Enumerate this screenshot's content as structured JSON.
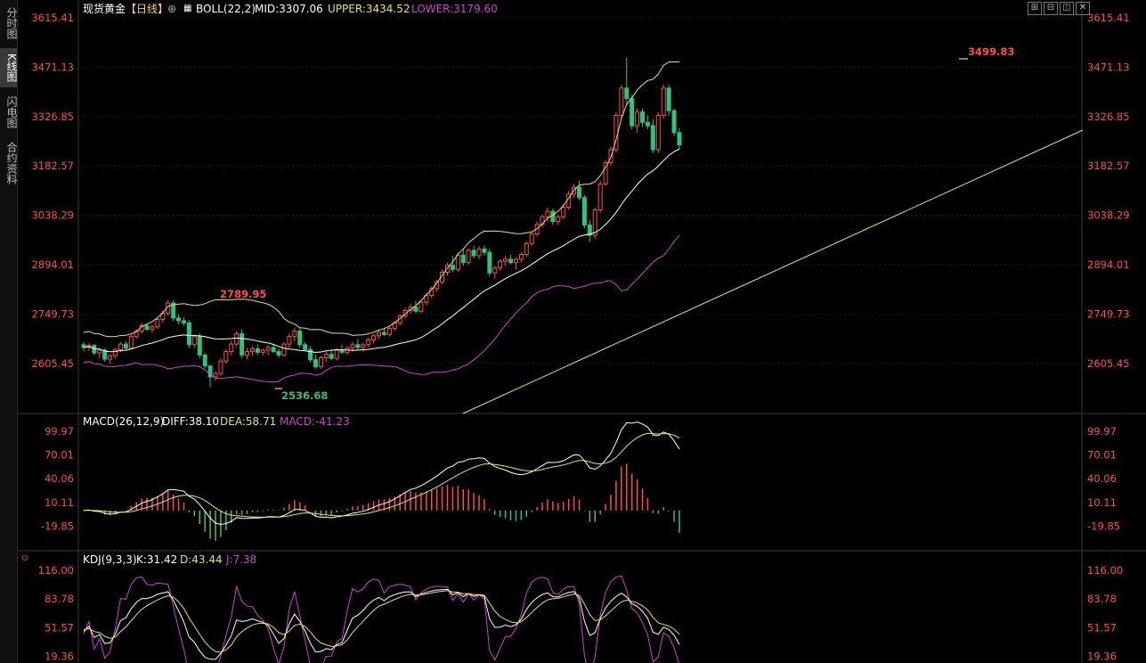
{
  "sidebar": {
    "tabs": [
      {
        "label": "分时图",
        "active": false
      },
      {
        "label": "K线图",
        "active": true
      },
      {
        "label": "闪电图",
        "active": false
      },
      {
        "label": "合约资料",
        "active": false
      }
    ]
  },
  "header": {
    "symbol": "现货黄金",
    "period": "【日线】",
    "indicator": "BOLL(22,2)",
    "mid": "MID:3307.06",
    "upper": "UPPER:3434.52",
    "lower": "LOWER:3179.60"
  },
  "toolbar": [
    {
      "icon": "expand-icon",
      "glyph": "⊞"
    },
    {
      "icon": "shrink-icon",
      "glyph": "⊟"
    },
    {
      "icon": "restore-icon",
      "glyph": "◫"
    },
    {
      "icon": "close-icon",
      "glyph": "✕"
    }
  ],
  "price_axis": {
    "labels": [
      "3615.41",
      "3471.13",
      "3326.85",
      "3182.57",
      "3038.29",
      "2894.01",
      "2749.73",
      "2605.45"
    ]
  },
  "price_annotations": [
    {
      "text": "3499.83",
      "color": "#ff4d4d"
    },
    {
      "text": "2789.95",
      "color": "#ff4d4d"
    },
    {
      "text": "2536.68",
      "color": "#2ec27e"
    }
  ],
  "macd": {
    "title": "MACD(26,12,9)",
    "diff": "DIFF:38.10",
    "dea": "DEA:58.71",
    "macd": "MACD:-41.23",
    "axis": [
      "99.97",
      "70.01",
      "40.06",
      "10.11",
      "-19.85"
    ]
  },
  "kdj": {
    "title": "KDJ(9,3,3)",
    "k": "K:31.42",
    "d": "D:43.44",
    "j": "J:7.38",
    "axis": [
      "116.00",
      "83.78",
      "51.57",
      "19.36"
    ]
  },
  "colors": {
    "up": "#ff4d4d",
    "down": "#2ec27e",
    "boll_upper": "#e6e659",
    "boll_mid": "#ffffff",
    "boll_lower": "#d23fd2",
    "trend": "#e6e659",
    "axis_text": "#ff4d4d",
    "grid": "#333333"
  },
  "chart_data": {
    "type": "candlestick",
    "price_range": [
      2536.68,
      3499.83
    ],
    "highest": 3499.83,
    "lowest": 2536.68,
    "ohlc": [
      [
        2660,
        2668,
        2640,
        2652
      ],
      [
        2652,
        2664,
        2642,
        2658
      ],
      [
        2658,
        2662,
        2630,
        2636
      ],
      [
        2636,
        2650,
        2620,
        2644
      ],
      [
        2644,
        2650,
        2610,
        2618
      ],
      [
        2618,
        2632,
        2605,
        2628
      ],
      [
        2628,
        2650,
        2620,
        2645
      ],
      [
        2645,
        2668,
        2638,
        2662
      ],
      [
        2662,
        2670,
        2645,
        2650
      ],
      [
        2650,
        2690,
        2646,
        2684
      ],
      [
        2684,
        2706,
        2678,
        2700
      ],
      [
        2700,
        2724,
        2692,
        2716
      ],
      [
        2716,
        2722,
        2700,
        2705
      ],
      [
        2705,
        2720,
        2695,
        2712
      ],
      [
        2712,
        2740,
        2706,
        2734
      ],
      [
        2734,
        2760,
        2725,
        2752
      ],
      [
        2752,
        2790,
        2745,
        2782
      ],
      [
        2782,
        2790,
        2730,
        2738
      ],
      [
        2738,
        2748,
        2720,
        2730
      ],
      [
        2730,
        2740,
        2715,
        2724
      ],
      [
        2724,
        2732,
        2650,
        2660
      ],
      [
        2660,
        2690,
        2650,
        2684
      ],
      [
        2684,
        2694,
        2620,
        2630
      ],
      [
        2630,
        2636,
        2590,
        2598
      ],
      [
        2598,
        2600,
        2536,
        2566
      ],
      [
        2566,
        2582,
        2555,
        2576
      ],
      [
        2576,
        2620,
        2570,
        2612
      ],
      [
        2612,
        2648,
        2605,
        2640
      ],
      [
        2640,
        2672,
        2630,
        2662
      ],
      [
        2662,
        2700,
        2652,
        2692
      ],
      [
        2692,
        2706,
        2620,
        2630
      ],
      [
        2630,
        2650,
        2618,
        2640
      ],
      [
        2640,
        2655,
        2628,
        2648
      ],
      [
        2648,
        2660,
        2630,
        2638
      ],
      [
        2638,
        2648,
        2628,
        2644
      ],
      [
        2644,
        2660,
        2630,
        2652
      ],
      [
        2652,
        2662,
        2636,
        2640
      ],
      [
        2640,
        2650,
        2622,
        2630
      ],
      [
        2630,
        2668,
        2626,
        2662
      ],
      [
        2662,
        2692,
        2650,
        2684
      ],
      [
        2684,
        2710,
        2670,
        2700
      ],
      [
        2700,
        2712,
        2652,
        2660
      ],
      [
        2660,
        2668,
        2640,
        2646
      ],
      [
        2646,
        2656,
        2610,
        2616
      ],
      [
        2616,
        2630,
        2590,
        2596
      ],
      [
        2596,
        2628,
        2590,
        2622
      ],
      [
        2622,
        2640,
        2610,
        2632
      ],
      [
        2632,
        2644,
        2616,
        2620
      ],
      [
        2620,
        2650,
        2614,
        2644
      ],
      [
        2644,
        2660,
        2632,
        2638
      ],
      [
        2638,
        2656,
        2630,
        2650
      ],
      [
        2650,
        2668,
        2640,
        2660
      ],
      [
        2660,
        2676,
        2646,
        2652
      ],
      [
        2652,
        2666,
        2640,
        2660
      ],
      [
        2660,
        2680,
        2652,
        2674
      ],
      [
        2674,
        2692,
        2664,
        2686
      ],
      [
        2686,
        2704,
        2676,
        2696
      ],
      [
        2696,
        2710,
        2686,
        2690
      ],
      [
        2690,
        2712,
        2684,
        2708
      ],
      [
        2708,
        2730,
        2700,
        2724
      ],
      [
        2724,
        2750,
        2716,
        2744
      ],
      [
        2744,
        2768,
        2736,
        2760
      ],
      [
        2760,
        2780,
        2750,
        2770
      ],
      [
        2770,
        2788,
        2752,
        2758
      ],
      [
        2758,
        2790,
        2752,
        2784
      ],
      [
        2784,
        2810,
        2776,
        2804
      ],
      [
        2804,
        2830,
        2796,
        2824
      ],
      [
        2824,
        2850,
        2816,
        2844
      ],
      [
        2844,
        2880,
        2836,
        2872
      ],
      [
        2872,
        2900,
        2862,
        2892
      ],
      [
        2892,
        2920,
        2872,
        2880
      ],
      [
        2880,
        2930,
        2872,
        2922
      ],
      [
        2922,
        2942,
        2890,
        2900
      ],
      [
        2900,
        2942,
        2894,
        2936
      ],
      [
        2936,
        2950,
        2912,
        2920
      ],
      [
        2920,
        2948,
        2910,
        2940
      ],
      [
        2940,
        2950,
        2920,
        2930
      ],
      [
        2930,
        2940,
        2860,
        2870
      ],
      [
        2870,
        2890,
        2852,
        2884
      ],
      [
        2884,
        2910,
        2876,
        2904
      ],
      [
        2904,
        2920,
        2890,
        2910
      ],
      [
        2910,
        2924,
        2896,
        2900
      ],
      [
        2900,
        2914,
        2880,
        2910
      ],
      [
        2910,
        2930,
        2900,
        2924
      ],
      [
        2924,
        2962,
        2916,
        2956
      ],
      [
        2956,
        2990,
        2948,
        2984
      ],
      [
        2984,
        3020,
        2976,
        3012
      ],
      [
        3012,
        3040,
        3004,
        3034
      ],
      [
        3034,
        3060,
        3020,
        3050
      ],
      [
        3050,
        3058,
        3010,
        3020
      ],
      [
        3020,
        3040,
        3010,
        3034
      ],
      [
        3034,
        3070,
        3026,
        3062
      ],
      [
        3062,
        3110,
        3054,
        3100
      ],
      [
        3100,
        3130,
        3090,
        3120
      ],
      [
        3120,
        3140,
        3082,
        3090
      ],
      [
        3090,
        3098,
        3000,
        3010
      ],
      [
        3010,
        3024,
        2960,
        2980
      ],
      [
        2980,
        3060,
        2970,
        3054
      ],
      [
        3054,
        3140,
        3046,
        3130
      ],
      [
        3130,
        3200,
        3124,
        3192
      ],
      [
        3192,
        3240,
        3182,
        3230
      ],
      [
        3230,
        3340,
        3222,
        3330
      ],
      [
        3330,
        3420,
        3320,
        3410
      ],
      [
        3410,
        3499,
        3360,
        3380
      ],
      [
        3380,
        3390,
        3290,
        3300
      ],
      [
        3300,
        3350,
        3280,
        3340
      ],
      [
        3340,
        3350,
        3296,
        3310
      ],
      [
        3310,
        3330,
        3290,
        3300
      ],
      [
        3300,
        3320,
        3220,
        3230
      ],
      [
        3230,
        3340,
        3220,
        3330
      ],
      [
        3330,
        3420,
        3320,
        3410
      ],
      [
        3410,
        3420,
        3330,
        3344
      ],
      [
        3344,
        3350,
        3270,
        3280
      ],
      [
        3280,
        3294,
        3230,
        3244
      ]
    ]
  }
}
